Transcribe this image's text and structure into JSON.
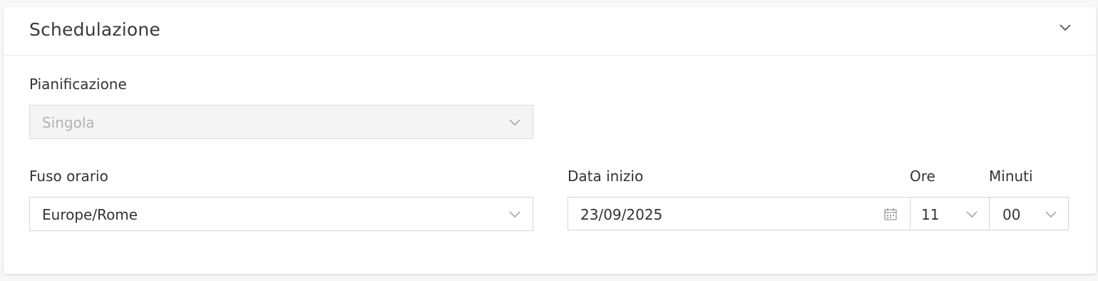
{
  "section": {
    "title": "Schedulazione"
  },
  "pianificazione": {
    "label": "Pianificazione",
    "value": "Singola",
    "disabled": true
  },
  "fuso_orario": {
    "label": "Fuso orario",
    "value": "Europe/Rome"
  },
  "data_inizio": {
    "label": "Data inizio",
    "value": "23/09/2025"
  },
  "ore": {
    "label": "Ore",
    "value": "11"
  },
  "minuti": {
    "label": "Minuti",
    "value": "00"
  },
  "icons": {
    "collapse": "chevron-down-icon",
    "dropdown": "chevron-down-icon",
    "calendar": "calendar-icon"
  },
  "colors": {
    "border": "#d6d6d6",
    "disabled_bg": "#f4f4f4",
    "disabled_text": "#b3b3b3",
    "text": "#333333",
    "icon": "#8a8a8a"
  }
}
